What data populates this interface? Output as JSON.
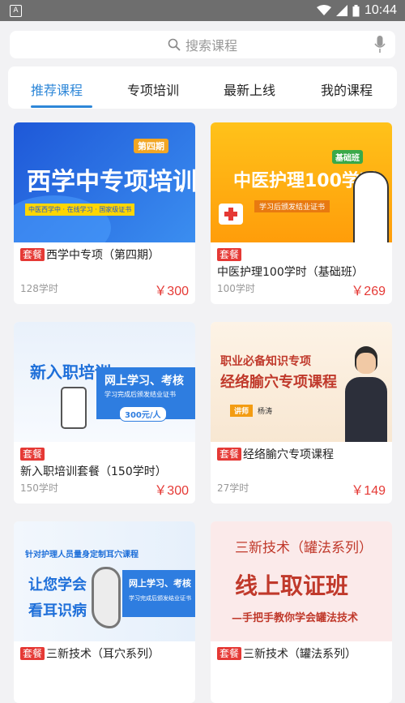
{
  "status": {
    "time": "10:44",
    "app_icon": "A"
  },
  "search": {
    "placeholder": "搜索课程"
  },
  "tabs": [
    {
      "label": "推荐课程"
    },
    {
      "label": "专项培训"
    },
    {
      "label": "最新上线"
    },
    {
      "label": "我的课程"
    }
  ],
  "badge_label": "套餐",
  "courses": [
    {
      "title": "西学中专项（第四期）",
      "hours": "128学时",
      "price": "￥300",
      "banner": {
        "headline": "西学中专项培训",
        "tag": "第四期",
        "sub": "中医西学中 · 在线学习 · 国家级证书"
      }
    },
    {
      "title": "中医护理100学时（基础班）",
      "hours": "100学时",
      "price": "￥269",
      "banner": {
        "headline": "中医护理100学时",
        "tag": "基础班",
        "sub": "学习后颁发结业证书"
      }
    },
    {
      "title": "新入职培训套餐（150学时）",
      "hours": "150学时",
      "price": "￥300",
      "banner": {
        "headline": "新入职培训",
        "sub1": "网上学习、考核",
        "sub2": "学习完成后颁发结业证书",
        "price_tag": "300元/人"
      }
    },
    {
      "title": "经络腧穴专项课程",
      "hours": "27学时",
      "price": "￥149",
      "banner": {
        "line1": "职业必备知识专项",
        "line2": "经络腧穴专项课程",
        "lecturer_tag": "讲师",
        "lecturer": "杨涛"
      }
    },
    {
      "title": "三新技术（耳穴系列）",
      "banner": {
        "top": "针对护理人员量身定制耳穴课程",
        "l1": "让您学会",
        "l2": "看耳识病",
        "r1": "网上学习、考核",
        "r2": "学习完成后颁发结业证书"
      }
    },
    {
      "title": "三新技术（罐法系列）",
      "banner": {
        "l1": "三新技术（罐法系列）",
        "l2": "线上取证班",
        "l3": "—手把手教你学会罐法技术"
      }
    }
  ],
  "colors": {
    "accent": "#2e87d8",
    "price": "#e53935",
    "badge": "#e53935"
  }
}
